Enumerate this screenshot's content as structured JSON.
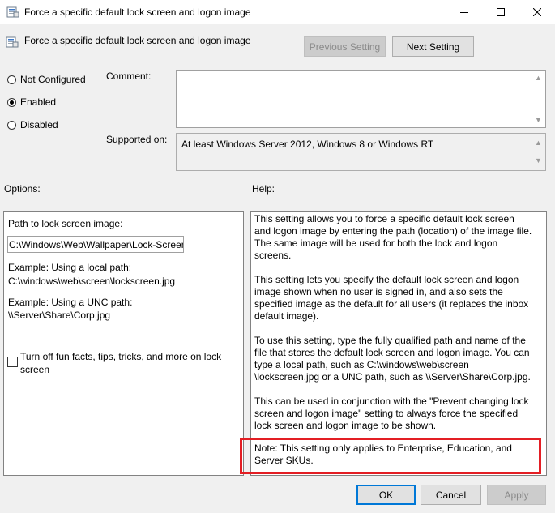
{
  "window": {
    "title": "Force a specific default lock screen and logon image"
  },
  "header": {
    "policy_name": "Force a specific default lock screen and logon image",
    "previous_setting_label": "Previous Setting",
    "next_setting_label": "Next Setting"
  },
  "state": {
    "options": [
      {
        "label": "Not Configured",
        "selected": false
      },
      {
        "label": "Enabled",
        "selected": true
      },
      {
        "label": "Disabled",
        "selected": false
      }
    ]
  },
  "comment": {
    "label": "Comment:",
    "value": ""
  },
  "supported": {
    "label": "Supported on:",
    "value": "At least Windows Server 2012, Windows 8 or Windows RT"
  },
  "options_section": {
    "label": "Options:",
    "path_label": "Path to lock screen image:",
    "path_value": "C:\\Windows\\Web\\Wallpaper\\Lock-Screen",
    "example_local_title": "Example: Using a local path:",
    "example_local_value": "C:\\windows\\web\\screen\\lockscreen.jpg",
    "example_unc_title": "Example: Using a UNC path:",
    "example_unc_value": "\\\\Server\\Share\\Corp.jpg",
    "fun_facts_label_line1": "Turn off fun facts, tips, tricks, and more on lock",
    "fun_facts_label_line2": "screen",
    "fun_facts_checked": false
  },
  "help_section": {
    "label": "Help:",
    "para1": "This setting allows you to force a specific default lock screen and logon image by entering the path (location) of the image file. The same image will be used for both the lock and logon screens.",
    "para2": "This setting lets you specify the default lock screen and logon image shown when no user is signed in, and also sets the specified image as the default for all users (it replaces the inbox default image).",
    "para3": "To use this setting, type the fully qualified path and name of the file that stores the default lock screen and logon image. You can type a local path, such as C:\\windows\\web\\screen \\lockscreen.jpg or a UNC path, such as \\\\Server\\Share\\Corp.jpg.",
    "para4": "This can be used in conjunction with the \"Prevent changing lock screen and logon image\" setting to always force the specified lock screen and logon image to be shown.",
    "note": "Note: This setting only applies to Enterprise, Education, and Server SKUs."
  },
  "footer": {
    "ok_label": "OK",
    "cancel_label": "Cancel",
    "apply_label": "Apply"
  },
  "colors": {
    "highlight_border": "#e31e24",
    "default_button_border": "#0078d7"
  }
}
